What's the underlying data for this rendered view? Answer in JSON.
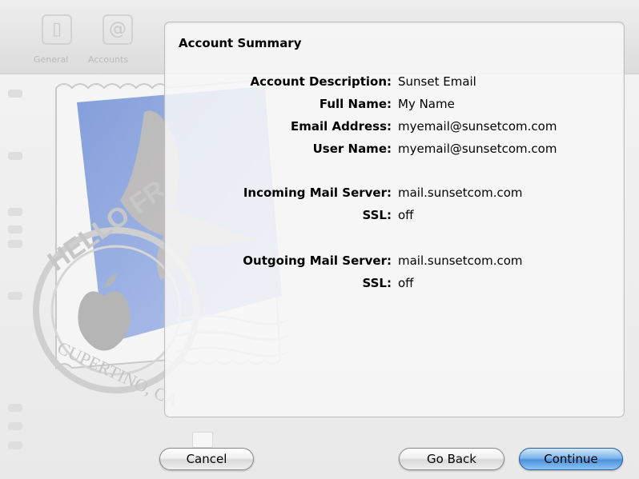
{
  "window": {
    "toolbar_items": [
      "General",
      "Accounts"
    ]
  },
  "panel": {
    "title": "Account Summary",
    "fields": [
      {
        "label": "Account Description:",
        "value": "Sunset Email"
      },
      {
        "label": "Full Name:",
        "value": "My Name"
      },
      {
        "label": "Email Address:",
        "value": "myemail@sunsetcom.com"
      },
      {
        "label": "User Name:",
        "value": "myemail@sunsetcom.com"
      },
      {
        "label": "Incoming Mail Server:",
        "value": "mail.sunsetcom.com"
      },
      {
        "label": "SSL:",
        "value": "off"
      },
      {
        "label": "Outgoing Mail Server:",
        "value": "mail.sunsetcom.com"
      },
      {
        "label": "SSL:",
        "value": "off"
      }
    ]
  },
  "stamp": {
    "postmark_top": "HELLO FR",
    "postmark_bottom": "CUPERTINO, CA"
  },
  "buttons": {
    "cancel": "Cancel",
    "go_back": "Go Back",
    "continue": "Continue"
  },
  "colors": {
    "stamp_blue": "#8fa6dc",
    "primary_button": "#4c93dc"
  }
}
